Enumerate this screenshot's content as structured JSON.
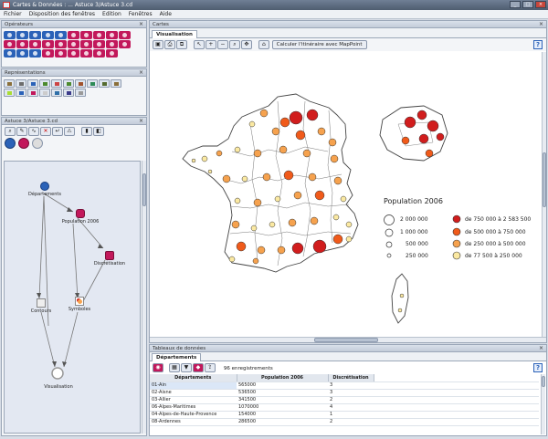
{
  "window": {
    "title": "Cartes & Données : ... Astuce 3/Astuce 3.cd"
  },
  "menu": [
    "Fichier",
    "Disposition des fenêtres",
    "Edition",
    "Fenêtres",
    "Aide"
  ],
  "operators_panel": {
    "title": "Opérateurs"
  },
  "representations_panel": {
    "title": "Représentations"
  },
  "workflow_panel": {
    "title": "Astuce 3/Astuce 3.cd",
    "nodes": {
      "departements": "Départements",
      "population": "Population 2006",
      "discretisation": "Discrétisation",
      "contours": "Contours",
      "symboles": "Symboles",
      "visualisation": "Visualisation"
    }
  },
  "maps_panel": {
    "title": "Cartes",
    "tab": "Visualisation",
    "mappoint_button": "Calculer l'itinéraire avec MapPoint",
    "help": "?"
  },
  "map": {
    "legend_title": "Population 2006",
    "size_legend": [
      "2 000 000",
      "1 000 000",
      "500 000",
      "250 000"
    ],
    "class_legend": [
      {
        "label": "de 750 000 à 2 583 500",
        "color": "#d11d1d"
      },
      {
        "label": "de 500 000 à 750 000",
        "color": "#f05a1a"
      },
      {
        "label": "de 250 000 à 500 000",
        "color": "#f6a24e"
      },
      {
        "label": "de 77 500 à 250 000",
        "color": "#fbe9a2"
      }
    ]
  },
  "data_panel": {
    "title": "Tableaux de données",
    "tab": "Départements",
    "record_count": "96 enregistrements",
    "help": "?",
    "columns": [
      "Départements",
      "Population 2006",
      "Discrétisation"
    ],
    "rows": [
      [
        "01-Ain",
        "565000",
        "3"
      ],
      [
        "02-Aisne",
        "536500",
        "3"
      ],
      [
        "03-Allier",
        "341500",
        "2"
      ],
      [
        "06-Alpes-Maritimes",
        "1070000",
        "4"
      ],
      [
        "04-Alpes-de-Haute-Provence",
        "154000",
        "1"
      ],
      [
        "08-Ardennes",
        "286500",
        "2"
      ]
    ]
  }
}
